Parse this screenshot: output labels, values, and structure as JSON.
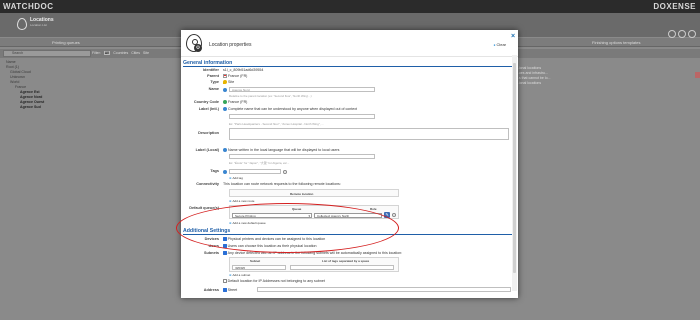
{
  "app": {
    "brand_left": "WATCHDOC",
    "brand_right": "DOXENSE",
    "page_title": "Locations",
    "page_subtitle": "Location List"
  },
  "queues_bar": {
    "left_label": "Printing queues",
    "right_label": "Finishing options templates"
  },
  "filter_bar": {
    "search_placeholder": "Search",
    "filters_label": "Filter:",
    "options": [
      "All",
      "Countries",
      "Cities",
      "Site"
    ]
  },
  "tree": {
    "header": "Name",
    "items": [
      {
        "label": "Root (1)",
        "level": 1
      },
      {
        "label": "Global Cloud",
        "level": 2
      },
      {
        "label": "Unknown",
        "level": 2
      },
      {
        "label": "World",
        "level": 2
      },
      {
        "label": "France",
        "level": 3
      },
      {
        "label": "Agence Est",
        "level": 4
      },
      {
        "label": "Agence Nord",
        "level": 4
      },
      {
        "label": "Agence Ouest",
        "level": 4
      },
      {
        "label": "Agence Sud",
        "level": 4
      }
    ]
  },
  "right_list": [
    "...ional locations",
    "...ues and infrastru...",
    "...s that cannot be lo...",
    "...ional locations"
  ],
  "modal": {
    "title": "Location properties",
    "clear_label": "Clear",
    "close": "×",
    "general_section": "General information",
    "identifier_label": "Identifier",
    "identifier_value": "s1l_c_809b51ad6d39554",
    "parent_label": "Parent",
    "parent_value": "France (FR)",
    "type_label": "Type",
    "type_value": "Site",
    "name_label": "Name",
    "name_value": "Agence Nord",
    "name_hint": "Relative to the parent location (ex: 'Second floor', 'North Wing'...)",
    "country_label": "Country Code",
    "country_value": "France (FR)",
    "label_intl_label": "Label (Intl.)",
    "label_intl_hint": "Complete name that can be understood by anyone when displayed out of context",
    "label_intl_example": "Ex: \"Paris Headquarters - Second floor\", \"Annex Hospital - North Wing\", ...",
    "description_label": "Description",
    "label_local_label": "Label (Local)",
    "label_local_hint": "Name written in the local language that will be displayed to local users",
    "label_local_example": "Ex: \"École\" for \"Japon\", \"大阪\" for Algeria, etc...",
    "tags_label": "Tags",
    "add_tag": "Add tag",
    "connectivity_label": "Connectivity",
    "connectivity_text": "This location can route network requests to the following remote locations:",
    "remote_location_header": "Remote location",
    "add_route": "Add a new route",
    "default_queues_label": "Default queue(s)",
    "queue_header": "Queue",
    "role_header": "Role",
    "queue_value": "Secure Printing",
    "role_value": "Collected: Agency North",
    "add_default_queue": "Add a new default queue",
    "additional_section": "Additional Settings",
    "devices_label": "Devices",
    "devices_text": "Physical printers and devices can be assigned to this location",
    "users_label": "Users",
    "users_text": "Users can choose this location as their physical location",
    "subnets_label": "Subnets",
    "subnets_text": "Any device detected with an IP address in the following subnets will be automatically assigned to this location:",
    "subnet_header": "Subnet",
    "subnet_tags_header": "List of tags separated by a space",
    "subnet_value": "/0/0/0/0",
    "add_subnet": "Add a subnet",
    "default_ip_text": "Default location for IP Addresses not belonging to any subnet",
    "address_label": "Address",
    "address_value": "Street"
  },
  "colors": {
    "accent": "#1f5fa8",
    "highlight": "#d42020"
  }
}
